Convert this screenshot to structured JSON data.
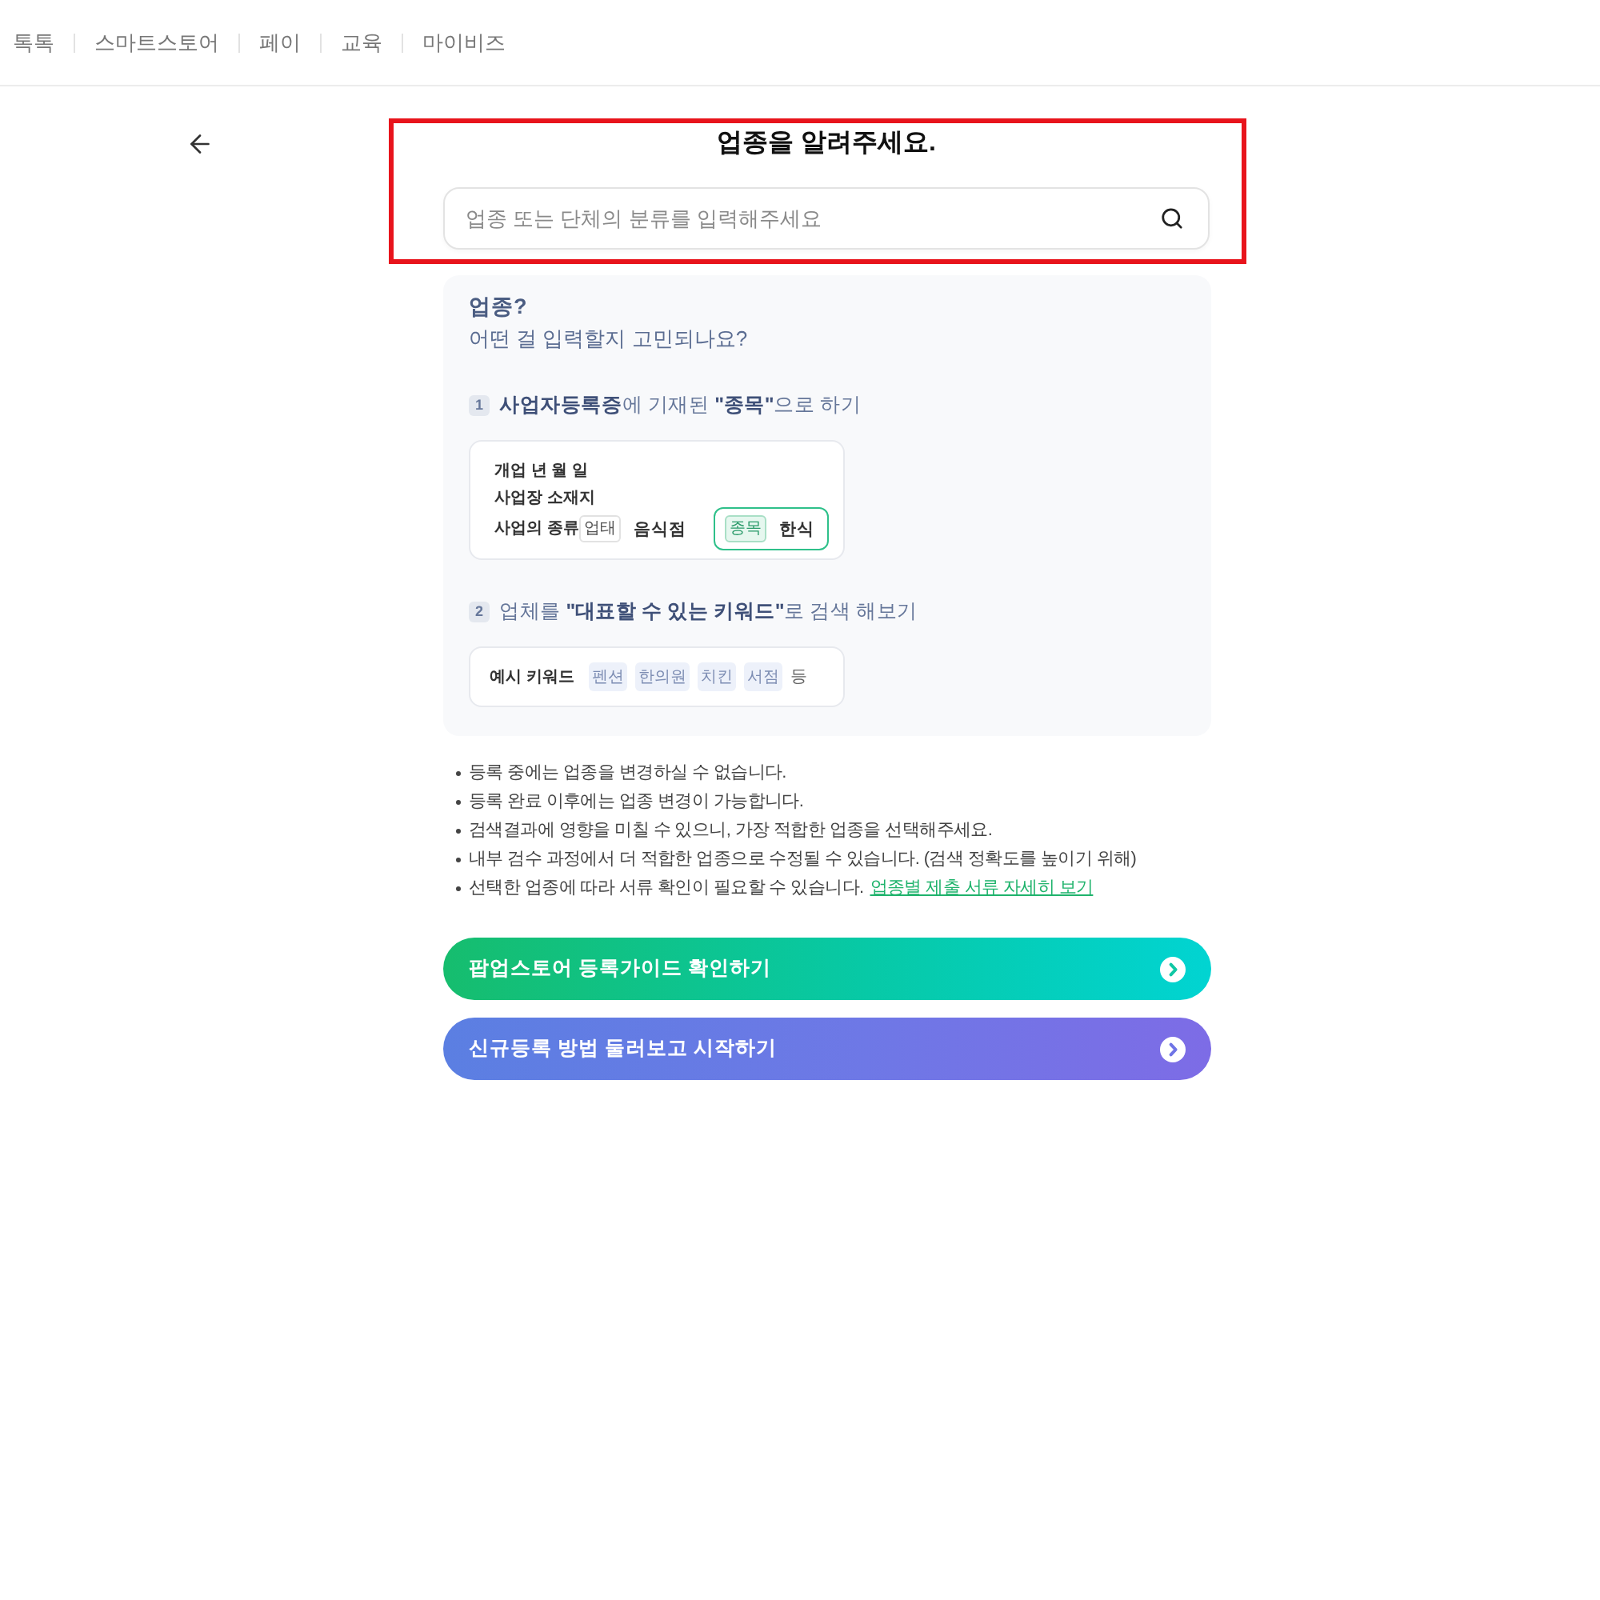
{
  "top_nav": {
    "items": [
      "톡톡",
      "스마트스토어",
      "페이",
      "교육",
      "마이비즈"
    ]
  },
  "header": {
    "highlighted": true,
    "title": "업종을 알려주세요.",
    "search": {
      "placeholder": "업종 또는 단체의 분류를 입력해주세요"
    }
  },
  "guide": {
    "title": "업종?",
    "subtitle": "어떤 걸 입력할지 고민되나요?",
    "steps": [
      {
        "kind": "certificate",
        "number": "1",
        "text": "**사업자등록증**에 기재된 **\"종목\"**으로 하기",
        "rows": [
          {
            "label": "개업 년 월 일"
          },
          {
            "label": "사업장 소재지"
          },
          {
            "label": "사업의 종류",
            "fields": [
              {
                "tag": "업태",
                "value": "음식점",
                "highlighted": false
              },
              {
                "tag": "종목",
                "value": "한식",
                "highlighted": true
              }
            ]
          }
        ]
      },
      {
        "kind": "keywords",
        "number": "2",
        "text": "업체를 **\"대표할 수 있는 키워드\"**로 검색 해보기",
        "label": "예시 키워드",
        "tags": [
          "펜션",
          "한의원",
          "치킨",
          "서점"
        ],
        "suffix": "등"
      }
    ]
  },
  "notes": [
    {
      "text": "등록 중에는 업종을 변경하실 수 없습니다."
    },
    {
      "text": "등록 완료 이후에는 업종 변경이 가능합니다."
    },
    {
      "text": "검색결과에 영향을 미칠 수 있으니, 가장 적합한 업종을 선택해주세요."
    },
    {
      "text": "내부 검수 과정에서 더 적합한 업종으로 수정될 수 있습니다. (검색 정확도를 높이기 위해)"
    },
    {
      "text": "선택한 업종에 따라 서류 확인이 필요할 수 있습니다.",
      "link": "업종별 제출 서류 자세히 보기"
    }
  ],
  "actions": [
    {
      "kind": "guide",
      "label": "팝업스토어 등록가이드 확인하기"
    },
    {
      "kind": "start",
      "label": "신규등록 방법 둘러보고 시작하기"
    }
  ]
}
